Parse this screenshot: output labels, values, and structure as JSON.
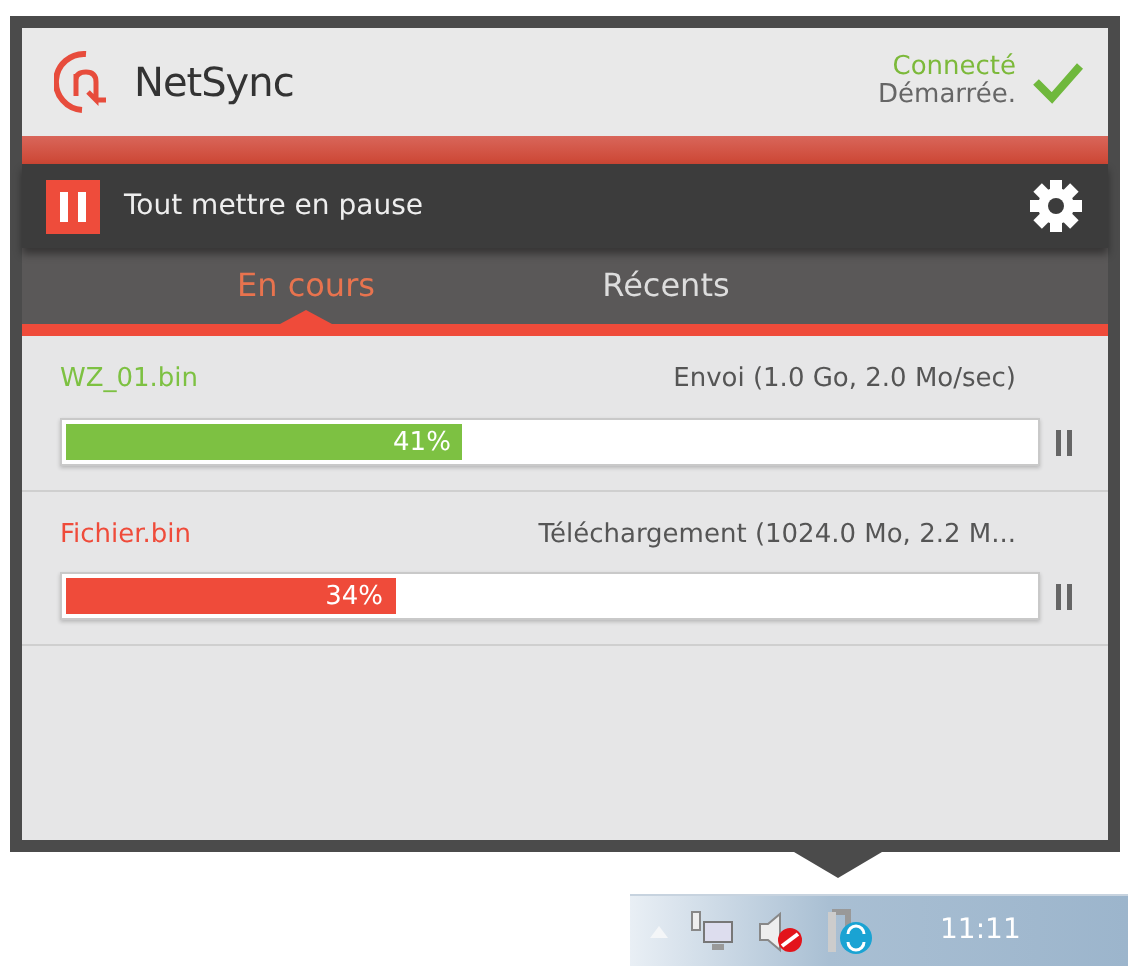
{
  "app": {
    "title": "NetSync",
    "status": "Connecté",
    "state": "Démarrée.",
    "connected": true
  },
  "toolbar": {
    "pause_all": "Tout mettre en pause"
  },
  "tabs": [
    {
      "label": "En cours",
      "selected": true
    },
    {
      "label": "Récents",
      "selected": false
    }
  ],
  "transfers": [
    {
      "name": "WZ_01.bin",
      "color": "#7dc142",
      "info": "Envoi (1.0 Go, 2.0 Mo/sec)",
      "level": 0.41,
      "percent": "41%"
    },
    {
      "name": "Fichier.bin",
      "color": "#ef4b3a",
      "info": "Téléchargement (1024.0 Mo, 2.2 M...",
      "level": 0.34,
      "percent": "34%"
    }
  ],
  "taskbar": {
    "clock": "11:11"
  }
}
